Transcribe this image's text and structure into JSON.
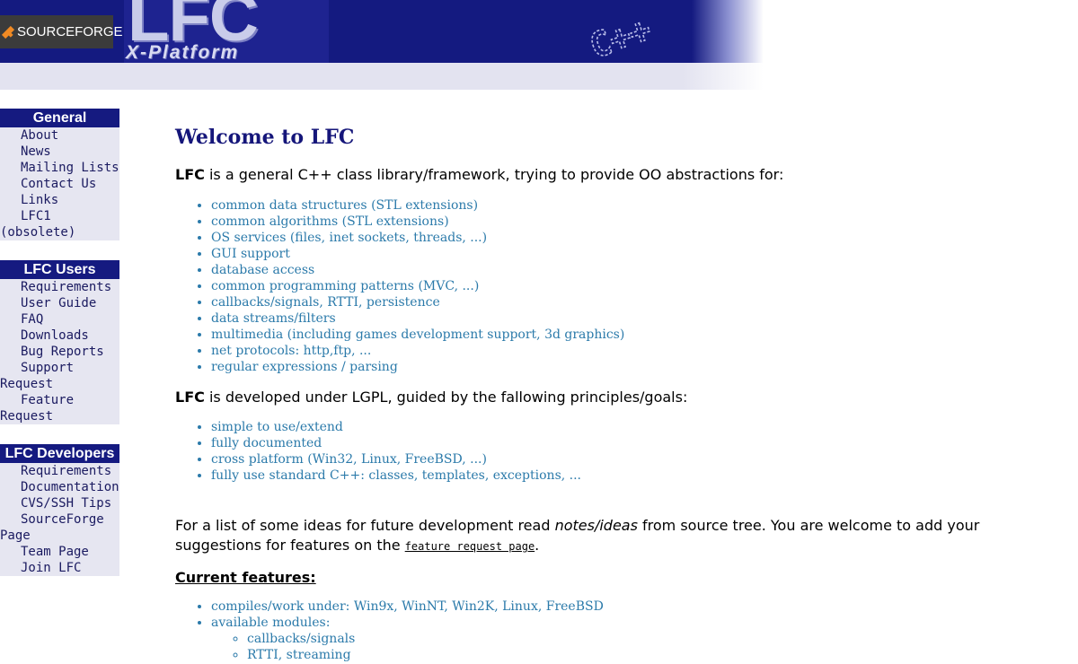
{
  "header": {
    "sourceforge_logo": "SOURCEFORGE",
    "lfc_logo_main": "LFC",
    "lfc_logo_sub": "X-Platform",
    "cpp_logo": "C++"
  },
  "sidebar": {
    "general": {
      "title": "General",
      "items": [
        "About",
        "News",
        "Mailing Lists",
        "Contact Us",
        "Links",
        "LFC1 (obsolete)"
      ]
    },
    "users": {
      "title": "LFC Users",
      "items": [
        "Requirements",
        "User Guide",
        "FAQ",
        "Downloads",
        "Bug Reports",
        "Support Request",
        "Feature Request"
      ]
    },
    "developers": {
      "title": "LFC Developers",
      "items": [
        "Requirements",
        "Documentation",
        "CVS/SSH Tips",
        "SourceForge Page",
        "Team Page",
        "Join LFC"
      ]
    }
  },
  "main": {
    "title": "Welcome to LFC",
    "intro_bold": "LFC",
    "intro_rest": " is a general C++ class library/framework, trying to provide OO abstractions for:",
    "abstractions": [
      "common data structures (STL extensions)",
      "common algorithms (STL extensions)",
      "OS services (files, inet sockets, threads, ...)",
      "GUI support",
      "database access",
      "common programming patterns (MVC, ...)",
      "callbacks/signals, RTTI, persistence",
      "data streams/filters",
      "multimedia (including games development support, 3d graphics)",
      "net protocols: http,ftp, ...",
      "regular expressions / parsing"
    ],
    "principles_bold": "LFC",
    "principles_rest": " is developed under LGPL, guided by the fallowing principles/goals:",
    "principles": [
      "simple to use/extend",
      "fully documented",
      "cross platform (Win32, Linux, FreeBSD, ...)",
      "fully use standard C++: classes, templates, exceptions, ..."
    ],
    "ideas_text_1": "For a list of some ideas for future development read ",
    "ideas_italic": "notes/ideas",
    "ideas_text_2": " from source tree. You are welcome to add your suggestions for features on the ",
    "ideas_link": "feature request page",
    "ideas_text_3": ".",
    "current_features_heading": "Current features:",
    "current_features": [
      "compiles/work under: Win9x, WinNT, Win2K, Linux, FreeBSD",
      "available modules:"
    ],
    "modules": [
      "callbacks/signals",
      "RTTI, streaming"
    ]
  },
  "colors": {
    "banner_blue": "#141a80",
    "nav_header": "#151a80",
    "nav_bg": "#e6e6f1",
    "link": "#2b7aaa",
    "title": "#15167a",
    "sourceforge_orange": "#f08a24"
  }
}
